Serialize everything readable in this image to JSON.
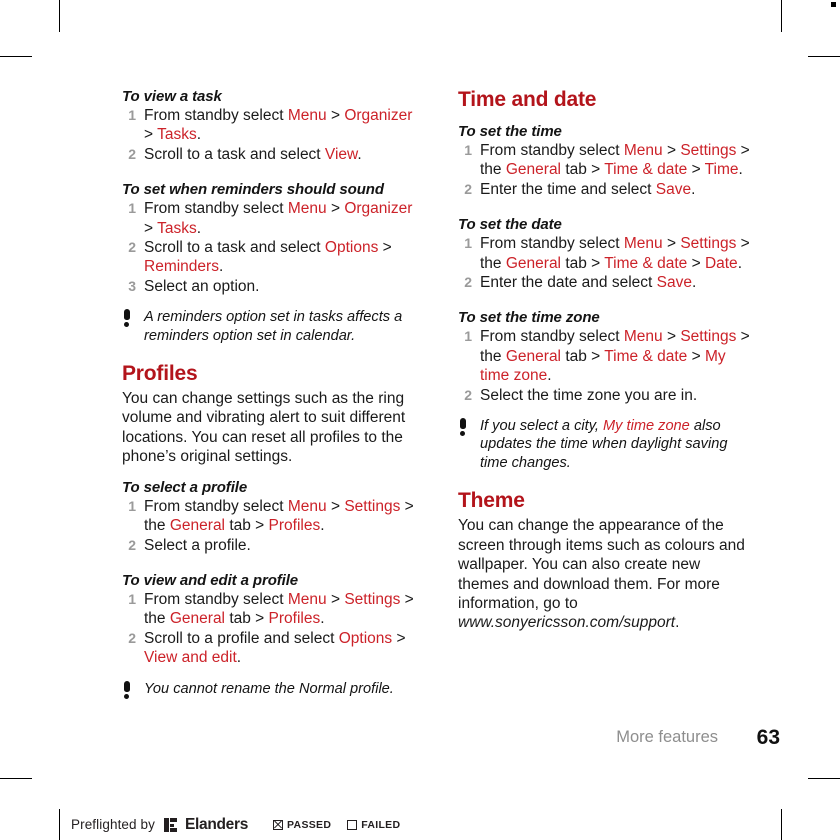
{
  "page": {
    "chapter_label": "More features",
    "page_number": "63"
  },
  "left_column": {
    "proc_view_task": {
      "title": "To view a task",
      "steps": [
        {
          "num": "1",
          "parts": [
            {
              "t": "From standby select ",
              "c": "black"
            },
            {
              "t": "Menu",
              "c": "red"
            },
            {
              "t": " > ",
              "c": "black"
            },
            {
              "t": "Organizer",
              "c": "red"
            },
            {
              "t": " > ",
              "c": "black"
            },
            {
              "t": "Tasks",
              "c": "red"
            },
            {
              "t": ".",
              "c": "black"
            }
          ]
        },
        {
          "num": "2",
          "parts": [
            {
              "t": "Scroll to a task and select ",
              "c": "black"
            },
            {
              "t": "View",
              "c": "red"
            },
            {
              "t": ".",
              "c": "black"
            }
          ]
        }
      ]
    },
    "proc_reminders_sound": {
      "title": "To set when reminders should sound",
      "steps": [
        {
          "num": "1",
          "parts": [
            {
              "t": "From standby select ",
              "c": "black"
            },
            {
              "t": "Menu",
              "c": "red"
            },
            {
              "t": " > ",
              "c": "black"
            },
            {
              "t": "Organizer",
              "c": "red"
            },
            {
              "t": " > ",
              "c": "black"
            },
            {
              "t": "Tasks",
              "c": "red"
            },
            {
              "t": ".",
              "c": "black"
            }
          ]
        },
        {
          "num": "2",
          "parts": [
            {
              "t": "Scroll to a task and select ",
              "c": "black"
            },
            {
              "t": "Options",
              "c": "red"
            },
            {
              "t": " > ",
              "c": "black"
            },
            {
              "t": "Reminders",
              "c": "red"
            },
            {
              "t": ".",
              "c": "black"
            }
          ]
        },
        {
          "num": "3",
          "parts": [
            {
              "t": "Select an option.",
              "c": "black"
            }
          ]
        }
      ]
    },
    "note_reminders": {
      "icon": "exclamation-icon",
      "parts": [
        {
          "t": "A reminders option set in tasks affects a reminders option set in calendar.",
          "c": "black"
        }
      ]
    },
    "section_profiles": {
      "heading": "Profiles",
      "body": "You can change settings such as the ring volume and vibrating alert to suit different locations. You can reset all profiles to the phone’s original settings."
    },
    "proc_select_profile": {
      "title": "To select a profile",
      "steps": [
        {
          "num": "1",
          "parts": [
            {
              "t": "From standby select ",
              "c": "black"
            },
            {
              "t": "Menu",
              "c": "red"
            },
            {
              "t": " > ",
              "c": "black"
            },
            {
              "t": "Settings",
              "c": "red"
            },
            {
              "t": " > the ",
              "c": "black"
            },
            {
              "t": "General",
              "c": "red"
            },
            {
              "t": " tab > ",
              "c": "black"
            },
            {
              "t": "Profiles",
              "c": "red"
            },
            {
              "t": ".",
              "c": "black"
            }
          ]
        },
        {
          "num": "2",
          "parts": [
            {
              "t": "Select a profile.",
              "c": "black"
            }
          ]
        }
      ]
    },
    "proc_view_edit_profile": {
      "title": "To view and edit a profile",
      "steps": [
        {
          "num": "1",
          "parts": [
            {
              "t": "From standby select ",
              "c": "black"
            },
            {
              "t": "Menu",
              "c": "red"
            },
            {
              "t": " > ",
              "c": "black"
            },
            {
              "t": "Settings",
              "c": "red"
            },
            {
              "t": " > the ",
              "c": "black"
            },
            {
              "t": "General",
              "c": "red"
            },
            {
              "t": " tab > ",
              "c": "black"
            },
            {
              "t": "Profiles",
              "c": "red"
            },
            {
              "t": ".",
              "c": "black"
            }
          ]
        },
        {
          "num": "2",
          "parts": [
            {
              "t": "Scroll to a profile and select ",
              "c": "black"
            },
            {
              "t": "Options",
              "c": "red"
            },
            {
              "t": " > ",
              "c": "black"
            },
            {
              "t": "View and edit",
              "c": "red"
            },
            {
              "t": ".",
              "c": "black"
            }
          ]
        }
      ]
    },
    "note_rename": {
      "icon": "exclamation-icon",
      "parts": [
        {
          "t": "You cannot rename the Normal profile.",
          "c": "black"
        }
      ]
    }
  },
  "right_column": {
    "section_time_and_date": {
      "heading": "Time and date"
    },
    "proc_set_time": {
      "title": "To set the time",
      "steps": [
        {
          "num": "1",
          "parts": [
            {
              "t": "From standby select ",
              "c": "black"
            },
            {
              "t": "Menu",
              "c": "red"
            },
            {
              "t": " > ",
              "c": "black"
            },
            {
              "t": "Settings",
              "c": "red"
            },
            {
              "t": " > the ",
              "c": "black"
            },
            {
              "t": "General",
              "c": "red"
            },
            {
              "t": " tab > ",
              "c": "black"
            },
            {
              "t": "Time & date",
              "c": "red"
            },
            {
              "t": " > ",
              "c": "black"
            },
            {
              "t": "Time",
              "c": "red"
            },
            {
              "t": ".",
              "c": "black"
            }
          ]
        },
        {
          "num": "2",
          "parts": [
            {
              "t": "Enter the time and select ",
              "c": "black"
            },
            {
              "t": "Save",
              "c": "red"
            },
            {
              "t": ".",
              "c": "black"
            }
          ]
        }
      ]
    },
    "proc_set_date": {
      "title": "To set the date",
      "steps": [
        {
          "num": "1",
          "parts": [
            {
              "t": "From standby select ",
              "c": "black"
            },
            {
              "t": "Menu",
              "c": "red"
            },
            {
              "t": " > ",
              "c": "black"
            },
            {
              "t": "Settings",
              "c": "red"
            },
            {
              "t": " > the ",
              "c": "black"
            },
            {
              "t": "General",
              "c": "red"
            },
            {
              "t": " tab > ",
              "c": "black"
            },
            {
              "t": "Time & date",
              "c": "red"
            },
            {
              "t": " > ",
              "c": "black"
            },
            {
              "t": "Date",
              "c": "red"
            },
            {
              "t": ".",
              "c": "black"
            }
          ]
        },
        {
          "num": "2",
          "parts": [
            {
              "t": "Enter the date and select ",
              "c": "black"
            },
            {
              "t": "Save",
              "c": "red"
            },
            {
              "t": ".",
              "c": "black"
            }
          ]
        }
      ]
    },
    "proc_set_time_zone": {
      "title": "To set the time zone",
      "steps": [
        {
          "num": "1",
          "parts": [
            {
              "t": "From standby select ",
              "c": "black"
            },
            {
              "t": "Menu",
              "c": "red"
            },
            {
              "t": " > ",
              "c": "black"
            },
            {
              "t": "Settings",
              "c": "red"
            },
            {
              "t": " > the ",
              "c": "black"
            },
            {
              "t": "General",
              "c": "red"
            },
            {
              "t": " tab > ",
              "c": "black"
            },
            {
              "t": "Time & date",
              "c": "red"
            },
            {
              "t": " > ",
              "c": "black"
            },
            {
              "t": "My time zone",
              "c": "red"
            },
            {
              "t": ".",
              "c": "black"
            }
          ]
        },
        {
          "num": "2",
          "parts": [
            {
              "t": "Select the time zone you are in.",
              "c": "black"
            }
          ]
        }
      ]
    },
    "note_city": {
      "icon": "exclamation-icon",
      "parts": [
        {
          "t": "If you select a city, ",
          "c": "black"
        },
        {
          "t": "My time zone",
          "c": "red"
        },
        {
          "t": " also updates the time when daylight saving time changes.",
          "c": "black"
        }
      ]
    },
    "section_theme": {
      "heading": "Theme",
      "body_parts": [
        {
          "t": "You can change the appearance of the screen through items such as colours and wallpaper. You can also create new themes and download them. For more information, go to ",
          "c": "black",
          "style": "normal"
        },
        {
          "t": "www.sonyericsson.com/support",
          "c": "black",
          "style": "italic"
        },
        {
          "t": ".",
          "c": "black",
          "style": "normal"
        }
      ]
    }
  },
  "preflight_bar": {
    "label": "Preflighted by",
    "brand": "Elanders",
    "passed_label": "PASSED",
    "failed_label": "FAILED",
    "passed_checked": true,
    "failed_checked": false
  },
  "colors": {
    "heading_red": "#b3141b",
    "link_red": "#cc2229",
    "step_number_gray": "#9a9a9a",
    "chapter_gray": "#8e8e8e",
    "body_black": "#1a1a1a"
  }
}
